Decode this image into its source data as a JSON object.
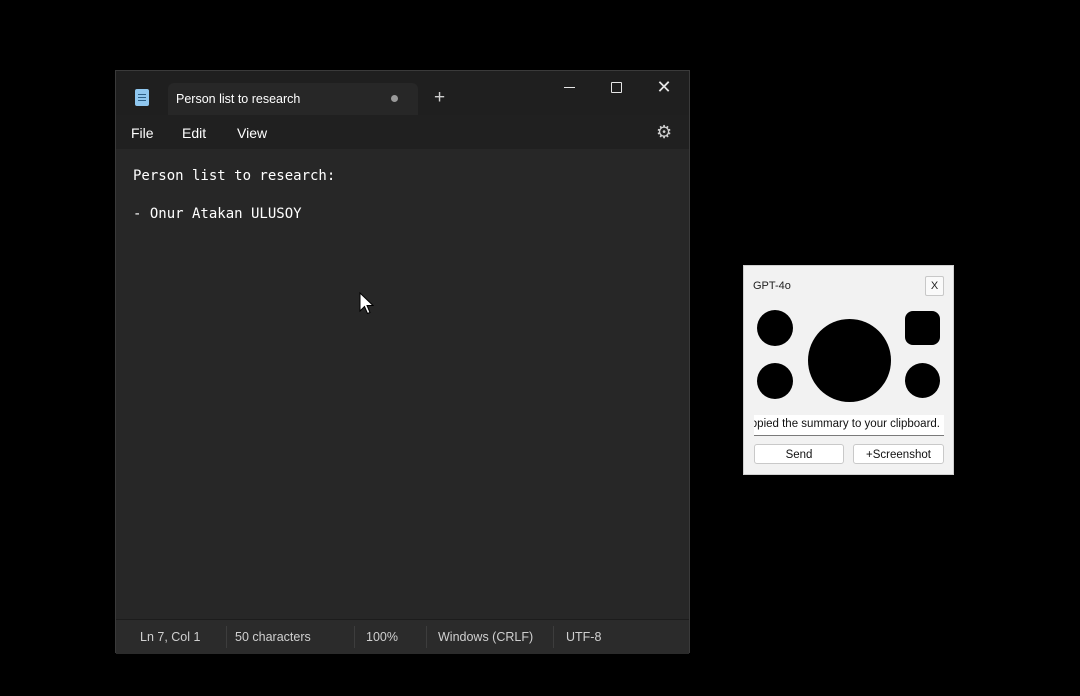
{
  "notepad": {
    "tab_title": "Person list to research",
    "new_tab_symbol": "+",
    "controls": {
      "minimize_icon": "minimize-icon",
      "maximize_icon": "maximize-icon",
      "close_symbol": "✕"
    },
    "menu": [
      "File",
      "Edit",
      "View"
    ],
    "settings_symbol": "⚙",
    "content_lines": [
      "Person list to research:",
      "",
      "- Onur Atakan ULUSOY"
    ],
    "status": {
      "position": "Ln 7, Col 1",
      "characters": "50 characters",
      "zoom": "100%",
      "line_ending": "Windows (CRLF)",
      "encoding": "UTF-8"
    }
  },
  "gpt_widget": {
    "title": "GPT-4o",
    "close_label": "X",
    "output_text": "opied the summary to your clipboard.",
    "send_label": "Send",
    "screenshot_label": "+Screenshot"
  },
  "colors": {
    "page_background": "#000000",
    "notepad_background": "#272727",
    "titlebar_background": "#1f1f1f",
    "widget_background": "#f2f2f2"
  }
}
